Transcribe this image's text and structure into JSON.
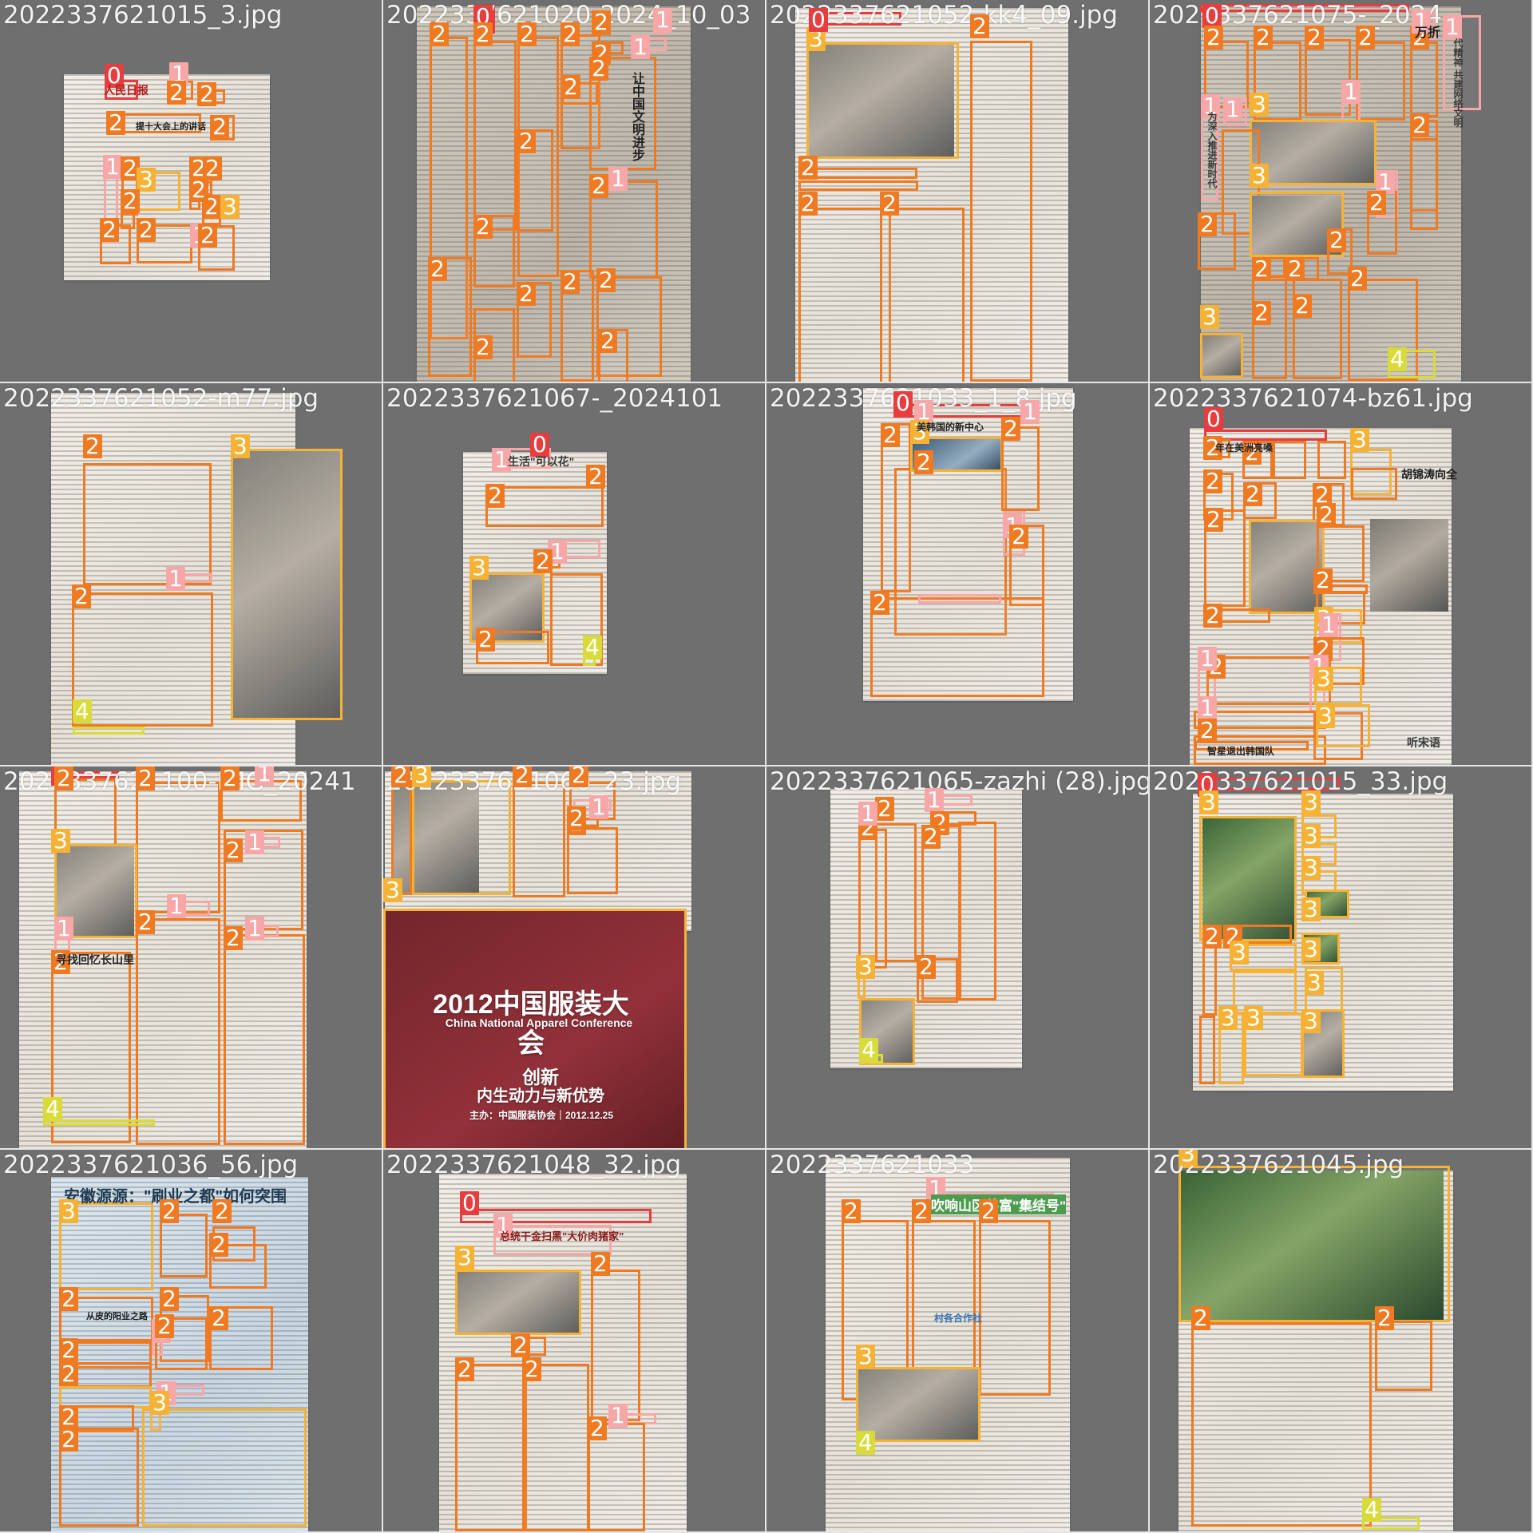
{
  "tiles": [
    {
      "filename": "2022337621015_3.jpg"
    },
    {
      "filename": "2022337621020-2024_10_03"
    },
    {
      "filename": "2022337621052-kk4_09.jpg"
    },
    {
      "filename": "2022337621075-_2024"
    },
    {
      "filename": "2022337621052-m77.jpg"
    },
    {
      "filename": "2022337621067-_2024101"
    },
    {
      "filename": "2022337621033_1_8.jpg"
    },
    {
      "filename": "2022337621074-bz61.jpg"
    },
    {
      "filename": "2022337621100-IMG_20241"
    },
    {
      "filename": "2022337621066_23.jpg"
    },
    {
      "filename": "2022337621065-zazhi (28).jpg"
    },
    {
      "filename": "2022337621015_33.jpg"
    },
    {
      "filename": "2022337621036_56.jpg"
    },
    {
      "filename": "2022337621048_32.jpg"
    },
    {
      "filename": "2022337621033"
    },
    {
      "filename": "2022337621045.jpg"
    }
  ],
  "labels": {
    "l0": "0",
    "l1": "1",
    "l2": "2",
    "l3": "3",
    "l4": "4"
  },
  "texts": {
    "tile1_header": "人民日报",
    "tile1_subhead": "提十大会上的讲话",
    "tile2_headline": "让中国文明进步",
    "tile4_headline": "万折",
    "tile4_side": "代精神 共建网络文明",
    "tile4_subhead": "为深入推进新时代",
    "tile6_head": "生活\"可以花\"",
    "tile7_head": "美韩国的新中心",
    "tile8_head1": "年在美洲亮嗓",
    "tile8_head2": "胡锦涛向全",
    "tile8_head3": "智星退出韩国队",
    "tile8_side": "听宋语",
    "tile9_head": "寻找回忆长山里",
    "tile10_title": "2012中国服装大会",
    "tile10_subtitle": "China National Apparel Conference",
    "tile10_main": "创新",
    "tile10_sub2": "内生动力与新优势",
    "tile10_small": "主办：中国服装协会｜2012.12.25",
    "tile13_head": "安徽源源：\"刷业之都\"如何突围",
    "tile13_sub": "从皮的阳业之路",
    "tile14_head": "总统干金扫黑\"大价肉猪家\"",
    "tile15_head": "吹响山区共富\"集结号\"",
    "tile15_side": "村各合作社"
  }
}
